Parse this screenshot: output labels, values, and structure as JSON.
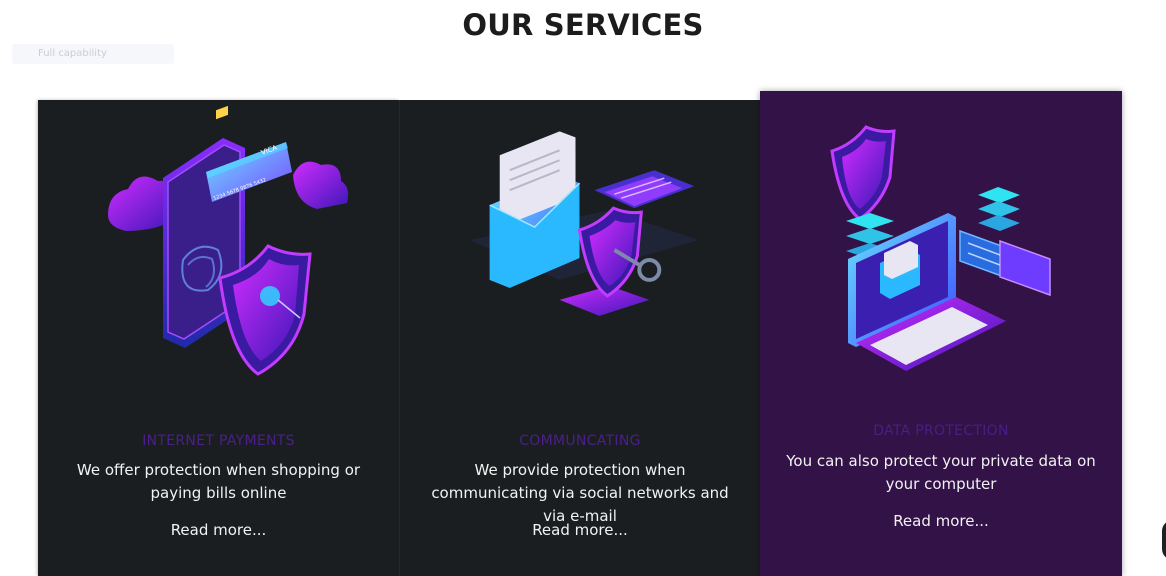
{
  "section": {
    "title": "OUR SERVICES"
  },
  "faint_tag": "Full capability",
  "cards": [
    {
      "title": "INTERNET PAYMENTS",
      "description": "We offer protection when shopping or paying bills online",
      "link": "Read more...",
      "card_brand": "VICA",
      "card_number": "1234 5678 9876 5432",
      "illustration": "phone-credit-card-shield"
    },
    {
      "title": "COMMUNCATING",
      "description": "We provide protection when communicating via social networks and via e-mail",
      "link": "Read more...",
      "illustration": "envelope-key-shield"
    },
    {
      "title": "DATA PROTECTION",
      "description": "You can also protect your private data on your computer",
      "link": "Read more...",
      "illustration": "laptop-shield-server"
    }
  ],
  "colors": {
    "card_bg": "#1b1e20",
    "active_card_bg": "#331247",
    "title_purple": "#4b1e8c",
    "accent_magenta": "#c02bff",
    "accent_cyan": "#2fd3ff"
  }
}
